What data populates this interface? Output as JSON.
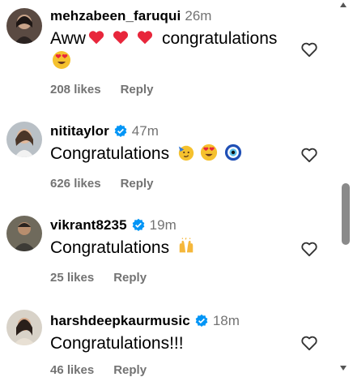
{
  "comments": [
    {
      "username": "mehzabeen_faruqui",
      "verified": false,
      "time": "26m",
      "text": "Aww",
      "text_after_emoji": "congratulations",
      "emojis": [
        "red-heart-emoji",
        "red-heart-emoji",
        "red-heart-emoji",
        "heart-eyes-emoji"
      ],
      "likes": "208 likes",
      "reply": "Reply"
    },
    {
      "username": "nititaylor",
      "verified": true,
      "time": "47m",
      "text": "Congratulations",
      "emojis": [
        "party-face-emoji",
        "heart-eyes-emoji",
        "nazar-amulet-emoji"
      ],
      "likes": "626 likes",
      "reply": "Reply"
    },
    {
      "username": "vikrant8235",
      "verified": true,
      "time": "19m",
      "text": "Congratulations",
      "emojis": [
        "raising-hands-emoji"
      ],
      "likes": "25 likes",
      "reply": "Reply"
    },
    {
      "username": "harshdeepkaurmusic",
      "verified": true,
      "time": "18m",
      "text": "Congratulations!!!",
      "emojis": [],
      "likes": "46 likes",
      "reply": "Reply"
    }
  ],
  "icons": {
    "like": "heart-outline-icon",
    "verified": "verified-badge-icon",
    "scroll_up": "scroll-up-arrow-icon",
    "scroll_down": "scroll-down-arrow-icon"
  },
  "colors": {
    "verified_blue": "#0095f6",
    "muted_text": "#737373",
    "heart_red": "#e8263b"
  }
}
